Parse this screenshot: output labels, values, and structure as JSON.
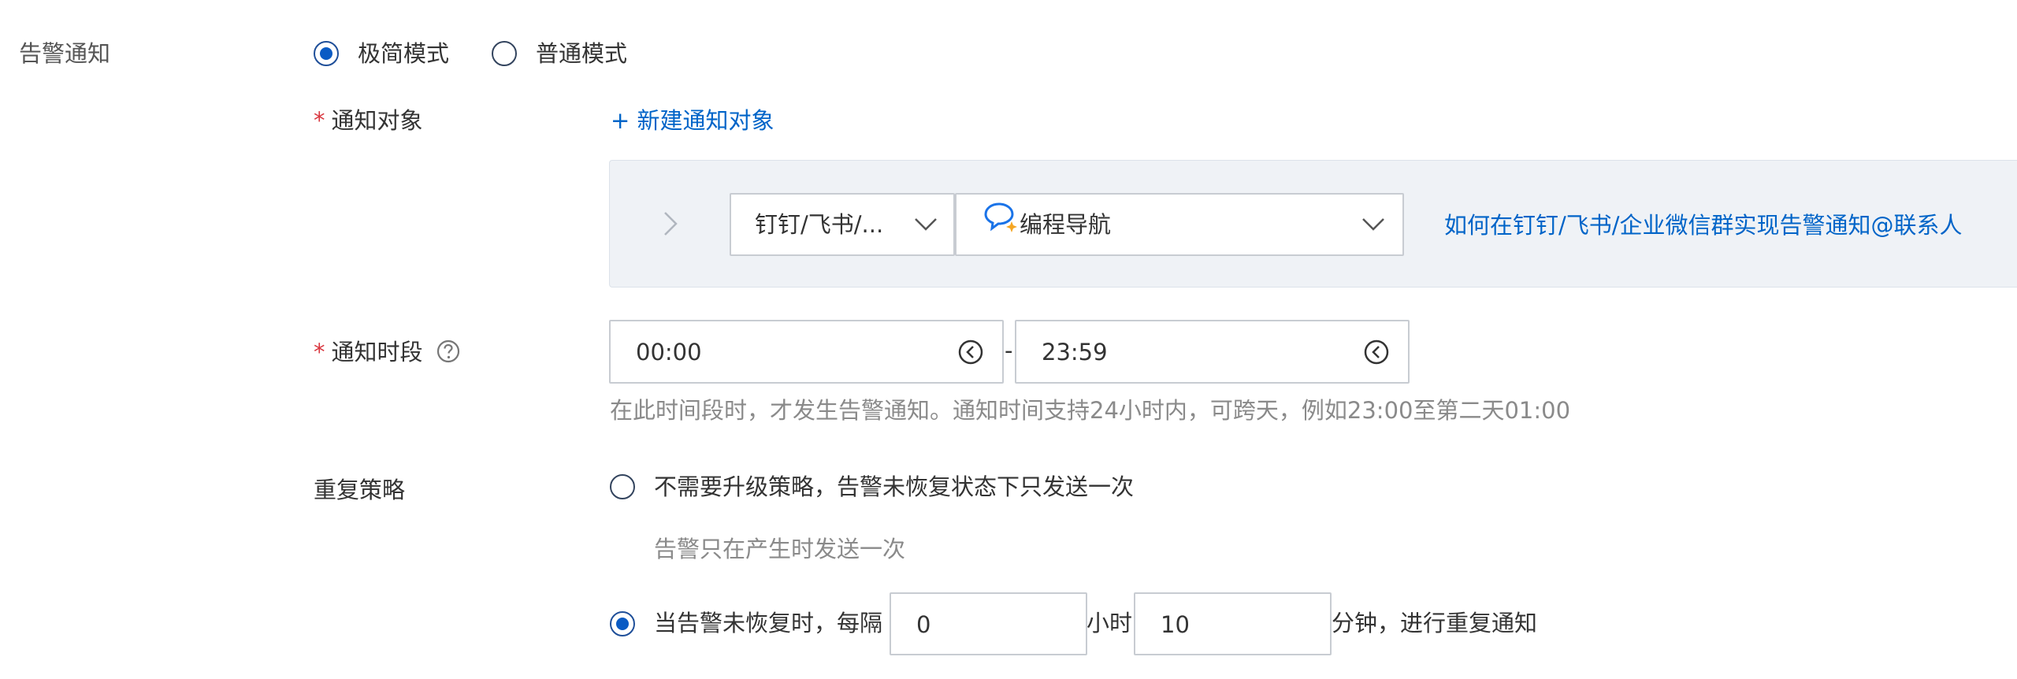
{
  "alert": {
    "label": "告警通知",
    "modes": [
      {
        "label": "极简模式",
        "checked": true
      },
      {
        "label": "普通模式",
        "checked": false
      }
    ]
  },
  "target": {
    "label": "通知对象",
    "required_mark": "*",
    "new_link": "+ 新建通知对象",
    "channel_select": "钉钉/飞书/...",
    "group_select": "编程导航",
    "help_link": "如何在钉钉/飞书/企业微信群实现告警通知@联系人"
  },
  "period": {
    "label": "通知时段",
    "required_mark": "*",
    "start": "00:00",
    "separator": "-",
    "end": "23:59",
    "hint": "在此时间段时，才发生告警通知。通知时间支持24小时内，可跨天，例如23:00至第二天01:00"
  },
  "repeat": {
    "label": "重复策略",
    "option1": {
      "label": "不需要升级策略，告警未恢复状态下只发送一次",
      "checked": false,
      "sub": "告警只在产生时发送一次"
    },
    "option2": {
      "checked": true,
      "prefix": "当告警未恢复时，每隔",
      "hours_value": "0",
      "hours_unit": "小时",
      "minutes_value": "10",
      "suffix": "分钟，进行重复通知"
    }
  },
  "colors": {
    "primary": "#0a5bc4",
    "link": "#0064c8",
    "required": "#d9363e",
    "panel_bg": "#eff2f6"
  }
}
